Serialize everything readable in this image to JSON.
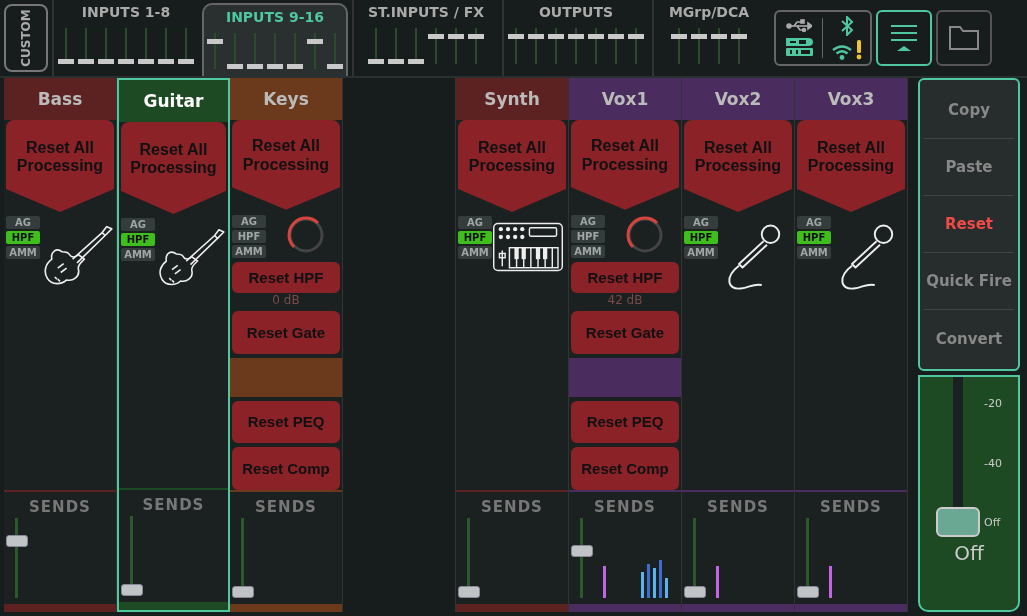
{
  "custom_button": {
    "label": "CUSTOM"
  },
  "banks": [
    {
      "label": "INPUTS 1-8",
      "selected": false
    },
    {
      "label": "INPUTS 9-16",
      "selected": true
    },
    {
      "label": "ST.INPUTS / FX",
      "selected": false
    },
    {
      "label": "OUTPUTS",
      "selected": false
    },
    {
      "label": "MGrp/DCA",
      "selected": false
    }
  ],
  "status": {
    "wifi_warning": true
  },
  "menu_button": {
    "selected": true
  },
  "channels": [
    {
      "kind": "guitar",
      "name": "Bass",
      "color": "#5c2121",
      "selected": false,
      "reset_all": "Reset All Processing",
      "badges": [
        {
          "label": "AG",
          "on": false
        },
        {
          "label": "HPF",
          "on": true
        },
        {
          "label": "AMM",
          "on": false
        }
      ],
      "sends_label": "SENDS",
      "send": {
        "level": 0.75
      },
      "activity": false
    },
    {
      "kind": "guitar",
      "name": "Guitar",
      "color": "#1d4a22",
      "selected": true,
      "reset_all": "Reset All Processing",
      "badges": [
        {
          "label": "AG",
          "on": false
        },
        {
          "label": "HPF",
          "on": true
        },
        {
          "label": "AMM",
          "on": false
        }
      ],
      "sends_label": "SENDS",
      "send": {
        "level": 0
      },
      "activity": false
    },
    {
      "kind": "processing",
      "name": "Keys",
      "color": "#6b3a1d",
      "selected": false,
      "reset_all": "Reset All Processing",
      "badges": [
        {
          "label": "AG",
          "on": false
        },
        {
          "label": "HPF",
          "on": false
        },
        {
          "label": "AMM",
          "on": false
        }
      ],
      "reading": "0 dB",
      "resets": [
        "Reset HPF",
        "Reset Gate",
        "Reset PEQ",
        "Reset Comp"
      ],
      "sends_label": "SENDS",
      "send": {
        "level": 0
      },
      "activity": false
    },
    {
      "kind": "empty"
    },
    {
      "kind": "keyboard",
      "name": "Synth",
      "color": "#5c2121",
      "selected": false,
      "reset_all": "Reset All Processing",
      "badges": [
        {
          "label": "AG",
          "on": false
        },
        {
          "label": "HPF",
          "on": true
        },
        {
          "label": "AMM",
          "on": false
        }
      ],
      "sends_label": "SENDS",
      "send": {
        "level": 0
      },
      "activity": false
    },
    {
      "kind": "processing",
      "name": "Vox1",
      "color": "#4a2d5e",
      "selected": false,
      "reset_all": "Reset All Processing",
      "badges": [
        {
          "label": "AG",
          "on": false
        },
        {
          "label": "HPF",
          "on": false
        },
        {
          "label": "AMM",
          "on": false
        }
      ],
      "reading": "42 dB",
      "resets": [
        "Reset HPF",
        "Reset Gate",
        "Reset PEQ",
        "Reset Comp"
      ],
      "sends_label": "SENDS",
      "send": {
        "level": 0.6
      },
      "activity": true
    },
    {
      "kind": "microphone",
      "name": "Vox2",
      "color": "#4a2d5e",
      "selected": false,
      "reset_all": "Reset All Processing",
      "badges": [
        {
          "label": "AG",
          "on": false
        },
        {
          "label": "HPF",
          "on": true
        },
        {
          "label": "AMM",
          "on": false
        }
      ],
      "sends_label": "SENDS",
      "send": {
        "level": 0
      },
      "activity": true
    },
    {
      "kind": "microphone",
      "name": "Vox3",
      "color": "#4a2d5e",
      "selected": false,
      "reset_all": "Reset All Processing",
      "badges": [
        {
          "label": "AG",
          "on": false
        },
        {
          "label": "HPF",
          "on": true
        },
        {
          "label": "AMM",
          "on": false
        }
      ],
      "sends_label": "SENDS",
      "send": {
        "level": 0
      },
      "activity": true
    }
  ],
  "actions": [
    {
      "label": "Copy",
      "selected": false
    },
    {
      "label": "Paste",
      "selected": false
    },
    {
      "label": "Reset",
      "selected": true
    },
    {
      "label": "Quick Fire",
      "selected": false
    },
    {
      "label": "Convert",
      "selected": false
    }
  ],
  "master": {
    "scale": [
      "-20",
      "-40",
      "Off"
    ],
    "level": 0,
    "label": "Off"
  }
}
